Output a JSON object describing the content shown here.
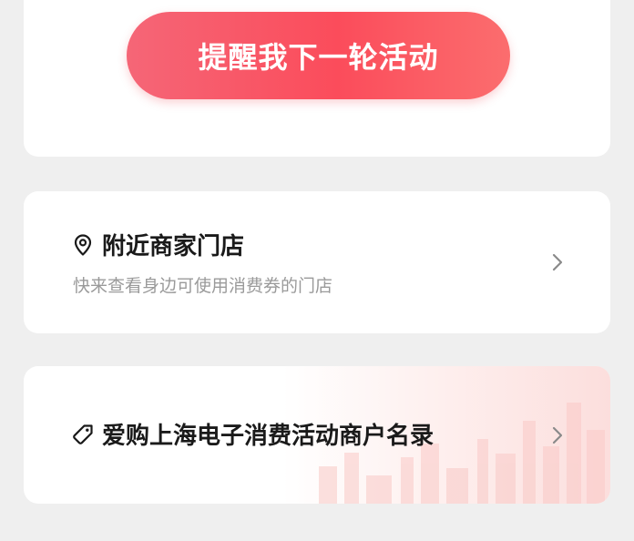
{
  "remind": {
    "button_label": "提醒我下一轮活动"
  },
  "nearby_stores": {
    "title": "附近商家门店",
    "subtitle": "快来查看身边可使用消费券的门店",
    "icon": "location-pin-icon"
  },
  "merchant_list": {
    "title": "爱购上海电子消费活动商户名录",
    "icon": "tag-icon"
  },
  "colors": {
    "button_start": "#f56677",
    "button_end": "#fb6d6e",
    "background": "#efefef",
    "card": "#ffffff",
    "subtitle_text": "#9a9a9a"
  }
}
